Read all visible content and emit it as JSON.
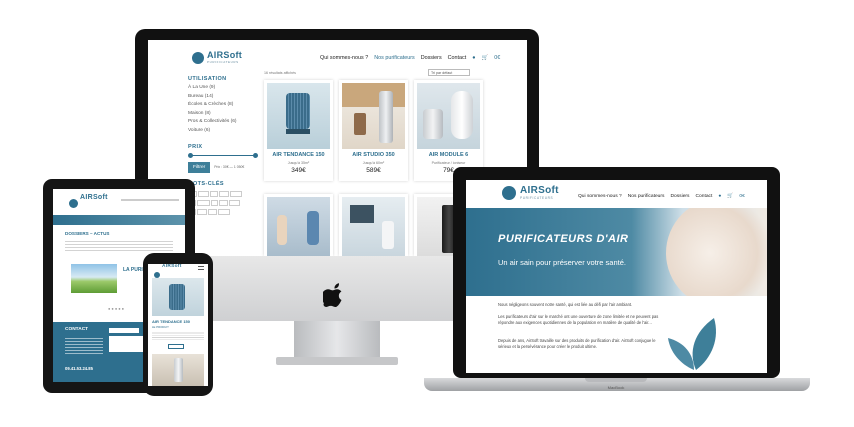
{
  "brand": {
    "name": "AIRSoft",
    "tagline": "PURIFICATEURS"
  },
  "nav": {
    "item1": "Qui sommes-nous ?",
    "item2": "Nos purificateurs",
    "item3": "Dossiers",
    "item4": "Contact",
    "cart": "0€"
  },
  "sidebar": {
    "usage_title": "UTILISATION",
    "usage_items": [
      "À La Une (9)",
      "Bureau (14)",
      "Écoles & Crèches (8)",
      "Maison (8)",
      "Pros & Collectivités (6)",
      "Voiture (6)"
    ],
    "price_title": "PRIX",
    "price_range": "Prix : 30€ — 1 050€",
    "filter_button": "Filtrer",
    "tags_title": "MOTS-CLÉS"
  },
  "sort": {
    "count_text": "16 résultats affichés",
    "selected": "Tri par défaut"
  },
  "products": [
    {
      "name": "AIR TENDANCE 150",
      "desc": "Jusqu'à 35m²",
      "price": "349€"
    },
    {
      "name": "AIR STUDIO 350",
      "desc": "Jusqu'à 60m²",
      "price": "589€"
    },
    {
      "name": "AIR MODULE 6",
      "desc": "Purificateur / ioniseur",
      "price": "79€"
    }
  ],
  "laptop": {
    "hero_title": "PURIFICATEURS D'AIR",
    "hero_subtitle": "Un air sain pour préserver votre santé.",
    "para1": "Nous négligeons souvent notre santé, qui est liée au défi par l'air ambiant.",
    "para2": "Les purificateurs d'air sur le marché ont une ouverture de zone limitée et ne peuvent pas répondre aux exigences quotidiennes de la population en matière de qualité de l'air...",
    "para3": "Depuis de ans, AirSoft travaille sur des produits de purification d'air. AirSoft conjugue le sérieux et la persévérance pour créer le produit ultime."
  },
  "tablet": {
    "section_title": "DOSSIERS – ACTUS",
    "hero_word": "LA PURIFICA...",
    "contact_title": "CONTACT",
    "phone": "09.41.53.24.85"
  },
  "phone_view": {
    "product_name": "AIR TENDANCE 150",
    "section": "LE PRODUIT"
  },
  "devices": {
    "laptop_label": "MacBook"
  },
  "colors": {
    "brand_blue": "#2e6f8e",
    "teal": "#3e7f99"
  }
}
